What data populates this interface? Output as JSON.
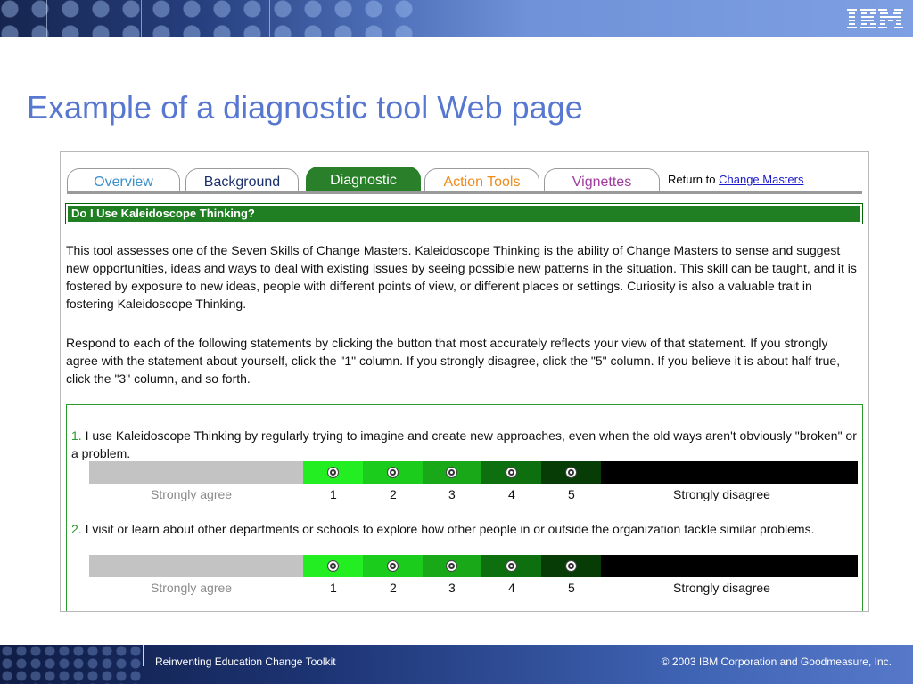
{
  "slide": {
    "title": "Example of a diagnostic tool Web page",
    "logo_text": "IBM"
  },
  "tabs": [
    {
      "label": "Overview",
      "color": "#3b8fcb"
    },
    {
      "label": "Background",
      "color": "#1b2f6b"
    },
    {
      "label": "Diagnostic",
      "color": "#ffffff",
      "active": true
    },
    {
      "label": "Action Tools",
      "color": "#f08a1a"
    },
    {
      "label": "Vignettes",
      "color": "#a03aa0"
    }
  ],
  "return_link": {
    "prefix": "Return to",
    "link_text": "Change Masters"
  },
  "section": {
    "title": "Do I Use Kaleidoscope Thinking?"
  },
  "intro": {
    "paragraph1": "This tool assesses one of the Seven Skills of Change Masters. Kaleidoscope Thinking is the ability of Change Masters to sense and suggest new opportunities, ideas and ways to deal with existing issues by seeing possible new patterns in the situation. This skill can be taught, and it is fostered by exposure to new ideas, people with different points of view, or different places or settings. Curiosity is also a valuable trait in fostering Kaleidoscope Thinking.",
    "paragraph2": "Respond to each of the following statements by clicking the button that most accurately reflects your view of that statement. If you strongly agree with the statement about yourself, click the \"1\" column. If you strongly disagree, click the \"5\" column. If you believe it is about half true, click the \"3\" column, and so forth."
  },
  "questions": [
    {
      "number": "1.",
      "text": "I use Kaleidoscope Thinking by regularly trying to imagine and create new approaches, even when the old ways aren't obviously \"broken\" or a problem."
    },
    {
      "number": "2.",
      "text": "I visit or learn about other departments or schools to explore how other people in or outside the organization tackle similar problems."
    }
  ],
  "scale": {
    "left_label": "Strongly agree",
    "right_label": "Strongly disagree",
    "options": [
      "1",
      "2",
      "3",
      "4",
      "5"
    ],
    "colors": {
      "agree_band": "#c3c3c3",
      "opt1": "#22ee22",
      "opt2": "#1ccc1c",
      "opt3": "#18a818",
      "opt4": "#0d6f0d",
      "opt5": "#073c07",
      "disagree_band": "#000000"
    }
  },
  "footer": {
    "left": "Reinventing Education Change Toolkit",
    "right": "© 2003 IBM Corporation and Goodmeasure, Inc."
  }
}
